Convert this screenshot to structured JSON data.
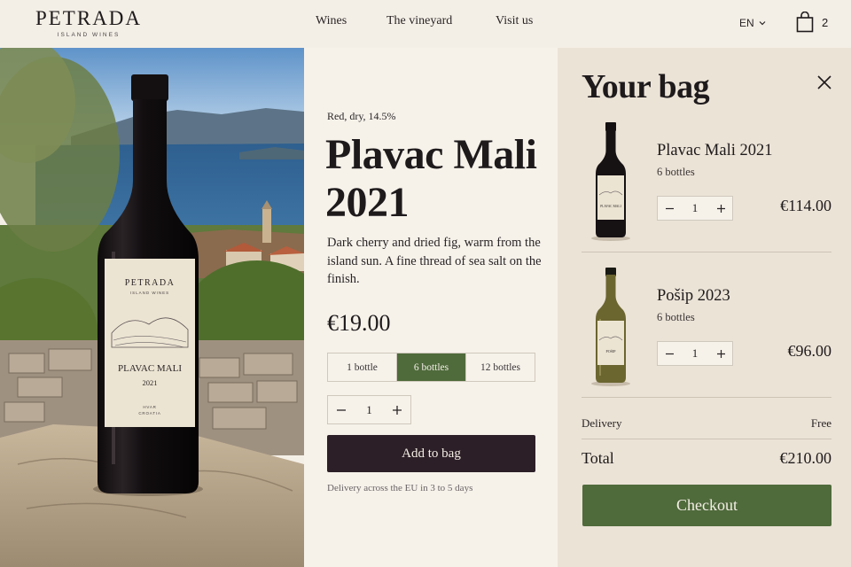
{
  "brand": {
    "name": "PETRADA",
    "tagline": "ISLAND WINES"
  },
  "nav": {
    "wines": "Wines",
    "vineyard": "The vineyard",
    "visit": "Visit us"
  },
  "header": {
    "language": "EN",
    "bag_count": "2"
  },
  "hero": {
    "label_brand": "PETRADA",
    "label_tagline": "ISLAND WINES",
    "label_name": "PLAVAC MALI",
    "label_year": "2021",
    "label_origin1": "HVAR",
    "label_origin2": "CROATIA"
  },
  "product": {
    "meta": "Red, dry, 14.5%",
    "title_line1": "Plavac Mali",
    "title_line2": "2021",
    "description": "Dark cherry and dried fig, warm from the island sun. A fine thread of sea salt on the finish.",
    "price": "€19.00",
    "sizes": [
      "1 bottle",
      "6 bottles",
      "12 bottles"
    ],
    "selected_size": "6 bottles",
    "quantity": "1",
    "add_label": "Add to bag",
    "delivery_note": "Delivery across the EU in 3 to 5 days"
  },
  "bag": {
    "title": "Your bag",
    "items": [
      {
        "name": "Plavac Mali 2021",
        "pack": "6 bottles",
        "quantity": "1",
        "price": "€114.00",
        "label_text": "PLAVAC MALI"
      },
      {
        "name": "Pošip 2023",
        "pack": "6 bottles",
        "quantity": "1",
        "price": "€96.00",
        "label_text": "POŠIP"
      }
    ],
    "delivery_label": "Delivery",
    "delivery_value": "Free",
    "total_label": "Total",
    "total_value": "€210.00",
    "checkout_label": "Checkout"
  },
  "colors": {
    "background": "#f4efe6",
    "bag_panel": "#ebe3d6",
    "accent_green": "#4f6a3b",
    "button_dark": "#2d1f27",
    "text": "#1e1a1c"
  },
  "icons": [
    "chevron-down-icon",
    "shopping-bag-icon",
    "close-icon",
    "minus-icon",
    "plus-icon"
  ]
}
